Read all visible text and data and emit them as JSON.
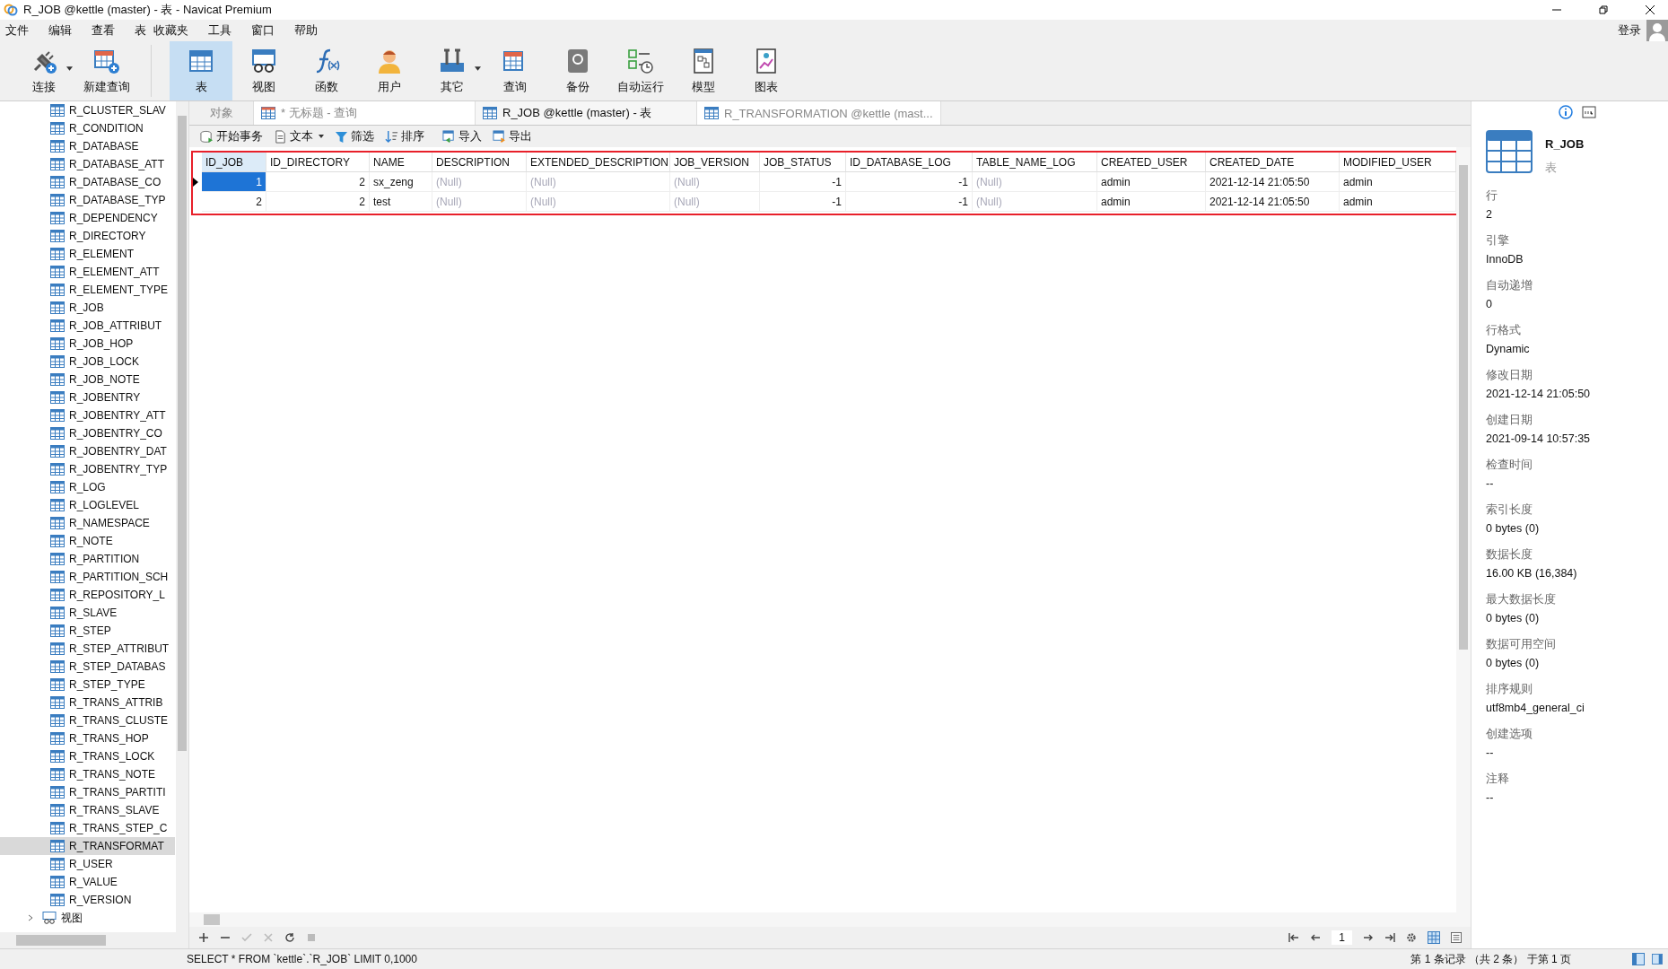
{
  "window": {
    "title": "R_JOB @kettle (master) - 表 - Navicat Premium"
  },
  "menu": [
    "文件",
    "编辑",
    "查看",
    "表",
    "收藏夹",
    "工具",
    "窗口",
    "帮助"
  ],
  "login": "登录",
  "toolbar": [
    {
      "kind": "plug",
      "label": "连接",
      "has_menu": true,
      "selected": false
    },
    {
      "kind": "newquery",
      "label": "新建查询",
      "has_menu": false,
      "selected": false
    },
    {
      "kind": "table",
      "label": "表",
      "has_menu": false,
      "selected": true
    },
    {
      "kind": "view",
      "label": "视图",
      "has_menu": false,
      "selected": false
    },
    {
      "kind": "function",
      "label": "函数",
      "has_menu": false,
      "selected": false
    },
    {
      "kind": "user",
      "label": "用户",
      "has_menu": false,
      "selected": false
    },
    {
      "kind": "tools",
      "label": "其它",
      "has_menu": true,
      "selected": false
    },
    {
      "kind": "query",
      "label": "查询",
      "has_menu": false,
      "selected": false
    },
    {
      "kind": "backup",
      "label": "备份",
      "has_menu": false,
      "selected": false
    },
    {
      "kind": "schedule",
      "label": "自动运行",
      "has_menu": false,
      "selected": false
    },
    {
      "kind": "model",
      "label": "模型",
      "has_menu": false,
      "selected": false
    },
    {
      "kind": "chart",
      "label": "图表",
      "has_menu": false,
      "selected": false
    }
  ],
  "sidebar": {
    "items": [
      {
        "label": "R_CLUSTER_SLAV",
        "selected": false
      },
      {
        "label": "R_CONDITION",
        "selected": false
      },
      {
        "label": "R_DATABASE",
        "selected": false
      },
      {
        "label": "R_DATABASE_ATT",
        "selected": false
      },
      {
        "label": "R_DATABASE_CO",
        "selected": false
      },
      {
        "label": "R_DATABASE_TYP",
        "selected": false
      },
      {
        "label": "R_DEPENDENCY",
        "selected": false
      },
      {
        "label": "R_DIRECTORY",
        "selected": false
      },
      {
        "label": "R_ELEMENT",
        "selected": false
      },
      {
        "label": "R_ELEMENT_ATT",
        "selected": false
      },
      {
        "label": "R_ELEMENT_TYPE",
        "selected": false
      },
      {
        "label": "R_JOB",
        "selected": false
      },
      {
        "label": "R_JOB_ATTRIBUT",
        "selected": false
      },
      {
        "label": "R_JOB_HOP",
        "selected": false
      },
      {
        "label": "R_JOB_LOCK",
        "selected": false
      },
      {
        "label": "R_JOB_NOTE",
        "selected": false
      },
      {
        "label": "R_JOBENTRY",
        "selected": false
      },
      {
        "label": "R_JOBENTRY_ATT",
        "selected": false
      },
      {
        "label": "R_JOBENTRY_CO",
        "selected": false
      },
      {
        "label": "R_JOBENTRY_DAT",
        "selected": false
      },
      {
        "label": "R_JOBENTRY_TYP",
        "selected": false
      },
      {
        "label": "R_LOG",
        "selected": false
      },
      {
        "label": "R_LOGLEVEL",
        "selected": false
      },
      {
        "label": "R_NAMESPACE",
        "selected": false
      },
      {
        "label": "R_NOTE",
        "selected": false
      },
      {
        "label": "R_PARTITION",
        "selected": false
      },
      {
        "label": "R_PARTITION_SCH",
        "selected": false
      },
      {
        "label": "R_REPOSITORY_L",
        "selected": false
      },
      {
        "label": "R_SLAVE",
        "selected": false
      },
      {
        "label": "R_STEP",
        "selected": false
      },
      {
        "label": "R_STEP_ATTRIBUT",
        "selected": false
      },
      {
        "label": "R_STEP_DATABAS",
        "selected": false
      },
      {
        "label": "R_STEP_TYPE",
        "selected": false
      },
      {
        "label": "R_TRANS_ATTRIB",
        "selected": false
      },
      {
        "label": "R_TRANS_CLUSTE",
        "selected": false
      },
      {
        "label": "R_TRANS_HOP",
        "selected": false
      },
      {
        "label": "R_TRANS_LOCK",
        "selected": false
      },
      {
        "label": "R_TRANS_NOTE",
        "selected": false
      },
      {
        "label": "R_TRANS_PARTITI",
        "selected": false
      },
      {
        "label": "R_TRANS_SLAVE",
        "selected": false
      },
      {
        "label": "R_TRANS_STEP_C",
        "selected": false
      },
      {
        "label": "R_TRANSFORMAT",
        "selected": true
      },
      {
        "label": "R_USER",
        "selected": false
      },
      {
        "label": "R_VALUE",
        "selected": false
      },
      {
        "label": "R_VERSION",
        "selected": false
      }
    ],
    "folder": {
      "label": "视图",
      "expanded": false
    }
  },
  "tabs": [
    {
      "label": "对象",
      "kind": "plain",
      "selected": false
    },
    {
      "label": "* 无标题 - 查询",
      "kind": "query",
      "selected": false
    },
    {
      "label": "R_JOB @kettle (master) - 表",
      "kind": "table",
      "selected": true
    },
    {
      "label": "R_TRANSFORMATION @kettle (mast...",
      "kind": "table",
      "selected": false
    }
  ],
  "actions": [
    {
      "kind": "transaction",
      "label": "开始事务",
      "has_menu": false
    },
    {
      "kind": "text",
      "label": "文本",
      "has_menu": true
    },
    {
      "kind": "filter",
      "label": "筛选",
      "has_menu": false
    },
    {
      "kind": "sort",
      "label": "排序",
      "has_menu": false
    },
    {
      "kind": "import",
      "label": "导入",
      "has_menu": false
    },
    {
      "kind": "export",
      "label": "导出",
      "has_menu": false
    }
  ],
  "table": {
    "columns": [
      {
        "label": "ID_JOB",
        "kind": "number",
        "selected": true
      },
      {
        "label": "ID_DIRECTORY",
        "kind": "number",
        "selected": false
      },
      {
        "label": "NAME",
        "kind": "text",
        "selected": false
      },
      {
        "label": "DESCRIPTION",
        "kind": "text",
        "selected": false
      },
      {
        "label": "EXTENDED_DESCRIPTION",
        "kind": "text",
        "selected": false
      },
      {
        "label": "JOB_VERSION",
        "kind": "text",
        "selected": false
      },
      {
        "label": "JOB_STATUS",
        "kind": "number",
        "selected": false
      },
      {
        "label": "ID_DATABASE_LOG",
        "kind": "number",
        "selected": false
      },
      {
        "label": "TABLE_NAME_LOG",
        "kind": "text",
        "selected": false
      },
      {
        "label": "CREATED_USER",
        "kind": "text",
        "selected": false
      },
      {
        "label": "CREATED_DATE",
        "kind": "text",
        "selected": false
      },
      {
        "label": "MODIFIED_USER",
        "kind": "text",
        "selected": false
      }
    ],
    "rows": [
      {
        "selected": true,
        "cells": [
          {
            "text": "1",
            "null": false
          },
          {
            "text": "2",
            "null": false
          },
          {
            "text": "sx_zeng",
            "null": false
          },
          {
            "text": "(Null)",
            "null": true
          },
          {
            "text": "(Null)",
            "null": true
          },
          {
            "text": "(Null)",
            "null": true
          },
          {
            "text": "-1",
            "null": false
          },
          {
            "text": "-1",
            "null": false
          },
          {
            "text": "(Null)",
            "null": true
          },
          {
            "text": "admin",
            "null": false
          },
          {
            "text": "2021-12-14 21:05:50",
            "null": false
          },
          {
            "text": "admin",
            "null": false
          }
        ]
      },
      {
        "selected": false,
        "cells": [
          {
            "text": "2",
            "null": false
          },
          {
            "text": "2",
            "null": false
          },
          {
            "text": "test",
            "null": false
          },
          {
            "text": "(Null)",
            "null": true
          },
          {
            "text": "(Null)",
            "null": true
          },
          {
            "text": "(Null)",
            "null": true
          },
          {
            "text": "-1",
            "null": false
          },
          {
            "text": "-1",
            "null": false
          },
          {
            "text": "(Null)",
            "null": true
          },
          {
            "text": "admin",
            "null": false
          },
          {
            "text": "2021-12-14 21:05:50",
            "null": false
          },
          {
            "text": "admin",
            "null": false
          }
        ]
      }
    ]
  },
  "pager": {
    "page": "1"
  },
  "info": {
    "name": "R_JOB",
    "type": "表",
    "properties": [
      {
        "label": "行",
        "value": "2"
      },
      {
        "label": "引擎",
        "value": "InnoDB"
      },
      {
        "label": "自动递增",
        "value": "0"
      },
      {
        "label": "行格式",
        "value": "Dynamic"
      },
      {
        "label": "修改日期",
        "value": "2021-12-14 21:05:50"
      },
      {
        "label": "创建日期",
        "value": "2021-09-14 10:57:35"
      },
      {
        "label": "检查时间",
        "value": "--"
      },
      {
        "label": "索引长度",
        "value": "0 bytes (0)"
      },
      {
        "label": "数据长度",
        "value": "16.00 KB (16,384)"
      },
      {
        "label": "最大数据长度",
        "value": "0 bytes (0)"
      },
      {
        "label": "数据可用空间",
        "value": "0 bytes (0)"
      },
      {
        "label": "排序规则",
        "value": "utf8mb4_general_ci"
      },
      {
        "label": "创建选项",
        "value": "--"
      },
      {
        "label": "注释",
        "value": "--"
      }
    ]
  },
  "status_bar": {
    "sql": "SELECT * FROM `kettle`.`R_JOB` LIMIT 0,1000",
    "records": "第 1 条记录 （共 2 条） 于第 1 页"
  }
}
